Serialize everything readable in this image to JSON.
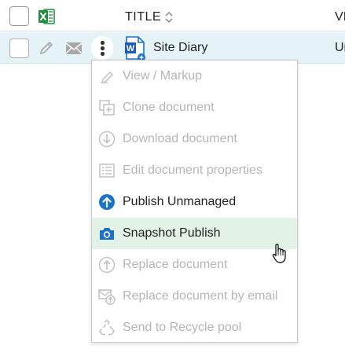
{
  "header": {
    "title_column": "TITLE",
    "next_column_partial": "VI"
  },
  "row": {
    "document_name": "Site Diary",
    "next_column_partial": "Ur"
  },
  "menu": {
    "items": [
      {
        "label": "View / Markup",
        "icon": "view-markup-icon",
        "enabled": false
      },
      {
        "label": "Clone document",
        "icon": "clone-icon",
        "enabled": false
      },
      {
        "label": "Download document",
        "icon": "download-icon",
        "enabled": false
      },
      {
        "label": "Edit document properties",
        "icon": "properties-icon",
        "enabled": false
      },
      {
        "label": "Publish Unmanaged",
        "icon": "publish-icon",
        "enabled": true
      },
      {
        "label": "Snapshot Publish",
        "icon": "camera-icon",
        "enabled": true,
        "highlighted": true
      },
      {
        "label": "Replace document",
        "icon": "replace-icon",
        "enabled": false
      },
      {
        "label": "Replace document by email",
        "icon": "replace-email-icon",
        "enabled": false
      },
      {
        "label": "Send to Recycle pool",
        "icon": "recycle-icon",
        "enabled": false
      }
    ]
  },
  "colors": {
    "accent": "#1a73c9",
    "row_selected_bg": "#e5f3f8",
    "menu_hover_bg": "#e3f2e6",
    "disabled_text": "#b5b5b5",
    "excel_green": "#1e8e3e"
  }
}
